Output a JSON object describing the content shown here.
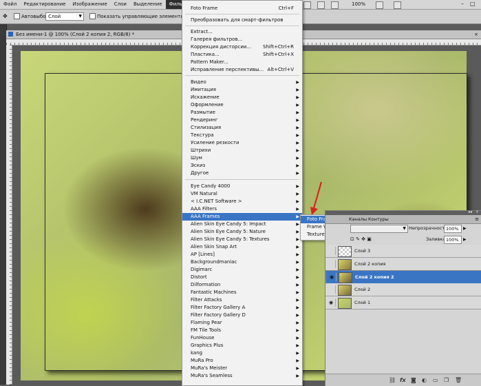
{
  "menubar": {
    "items": [
      "Файл",
      "Редактирование",
      "Изображение",
      "Слои",
      "Выделение",
      "Фильтр"
    ],
    "zoom": "100%"
  },
  "options": {
    "autoselect_label": "Автовыбор:",
    "autoselect_value": "Слой",
    "show_controls_label": "Показать управляющие элементы"
  },
  "document": {
    "tab_title": "Без имени-1 @ 100% (Слой 2 копия 2, RGB/8) *"
  },
  "filter_menu": {
    "items": [
      {
        "label": "Foto Frame",
        "shortcut": "Ctrl+F"
      },
      {
        "label": "Преобразовать для смарт-фильтров"
      },
      {
        "label": "Extract..."
      },
      {
        "label": "Галерея фильтров..."
      },
      {
        "label": "Коррекция дисторсии...",
        "shortcut": "Shift+Ctrl+R"
      },
      {
        "label": "Пластика...",
        "shortcut": "Shift+Ctrl+X"
      },
      {
        "label": "Pattern Maker..."
      },
      {
        "label": "Исправление перспективы...",
        "shortcut": "Alt+Ctrl+V"
      },
      {
        "label": "Видео"
      },
      {
        "label": "Имитация"
      },
      {
        "label": "Искажение"
      },
      {
        "label": "Оформление"
      },
      {
        "label": "Размытие"
      },
      {
        "label": "Рендеринг"
      },
      {
        "label": "Стилизация"
      },
      {
        "label": "Текстура"
      },
      {
        "label": "Усиление резкости"
      },
      {
        "label": "Штрихи"
      },
      {
        "label": "Шум"
      },
      {
        "label": "Эскиз"
      },
      {
        "label": "Другое"
      },
      {
        "label": "Eye Candy 4000"
      },
      {
        "label": "VM Natural"
      },
      {
        "label": "< I.C.NET Software >"
      },
      {
        "label": "AAA Filters"
      },
      {
        "label": "AAA Frames"
      },
      {
        "label": "Alien Skin Eye Candy 5: Impact"
      },
      {
        "label": "Alien Skin Eye Candy 5: Nature"
      },
      {
        "label": "Alien Skin Eye Candy 5: Textures"
      },
      {
        "label": "Alien Skin Snap Art"
      },
      {
        "label": "AP [Lines]"
      },
      {
        "label": "Backgroundmaniac"
      },
      {
        "label": "Digimarc"
      },
      {
        "label": "Distort"
      },
      {
        "label": "Dilformation"
      },
      {
        "label": "Fantastic Machines"
      },
      {
        "label": "Filter Attacks"
      },
      {
        "label": "Filter Factory Gallery A"
      },
      {
        "label": "Filter Factory Gallery D"
      },
      {
        "label": "Flaming Pear"
      },
      {
        "label": "FM Tile Tools"
      },
      {
        "label": "FunHouse"
      },
      {
        "label": "Graphics Plus"
      },
      {
        "label": "kang"
      },
      {
        "label": "MuRa Pro"
      },
      {
        "label": "MuRa's Meister"
      },
      {
        "label": "MuRa's Seamless"
      }
    ]
  },
  "submenu": {
    "items": [
      "Foto Frame...",
      "Frame Works...",
      "Texture Frame..."
    ]
  },
  "layers_panel": {
    "tabs": [
      "Каналы",
      "Контуры"
    ],
    "opacity_label": "Непрозрачность:",
    "opacity_value": "100%",
    "fill_label": "Заливка:",
    "fill_value": "100%",
    "layers": [
      "Слой 3",
      "Слой 2 копия",
      "Слой 2 копия 2",
      "Слой 2",
      "Слой 1"
    ],
    "selected_layer": "Слой 2 копия 2",
    "bottom_icons": [
      "link-icon",
      "fx-icon",
      "mask-icon",
      "adjustment-icon",
      "group-icon",
      "new-layer-icon",
      "trash-icon"
    ]
  },
  "colors": {
    "highlight": "#3a75c4",
    "arrow": "#d8251c"
  }
}
